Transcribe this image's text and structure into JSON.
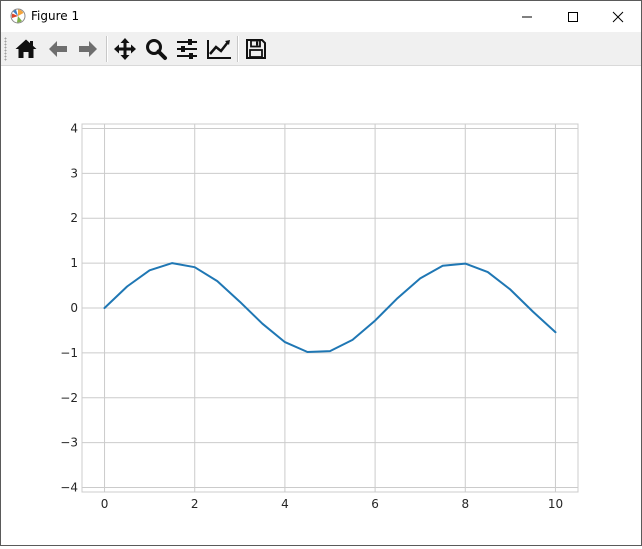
{
  "window": {
    "title": "Figure 1",
    "controls": [
      "minimize-icon",
      "maximize-icon",
      "close-icon"
    ]
  },
  "toolbar": {
    "tools": [
      "home-icon",
      "back-arrow-icon",
      "forward-arrow-icon",
      "pan-icon",
      "zoom-icon",
      "subplots-config-icon",
      "edit-curves-icon",
      "save-icon"
    ]
  },
  "chart_data": {
    "type": "line",
    "title": "",
    "xlabel": "",
    "ylabel": "",
    "xlim": [
      -0.5,
      10.5
    ],
    "ylim": [
      -4.1,
      4.1
    ],
    "xticks": [
      0,
      2,
      4,
      6,
      8,
      10
    ],
    "yticks": [
      4,
      3,
      2,
      1,
      0,
      -1,
      -2,
      -3,
      -4
    ],
    "ytick_labels": [
      "4",
      "3",
      "2",
      "1",
      "0",
      "−1",
      "−2",
      "−3",
      "−4"
    ],
    "grid": true,
    "line_color": "#1f77b4",
    "grid_color": "#cbcbcb",
    "series": [
      {
        "x": [
          0,
          0.5,
          1,
          1.5,
          2,
          2.5,
          3,
          3.5,
          4,
          4.5,
          5,
          5.5,
          6,
          6.5,
          7,
          7.5,
          8,
          8.5,
          9,
          9.5,
          10
        ],
        "y": [
          0.0,
          0.48,
          0.84,
          1.0,
          0.91,
          0.6,
          0.14,
          -0.35,
          -0.76,
          -0.98,
          -0.96,
          -0.71,
          -0.28,
          0.22,
          0.66,
          0.94,
          0.99,
          0.8,
          0.41,
          -0.08,
          -0.54
        ]
      }
    ]
  }
}
